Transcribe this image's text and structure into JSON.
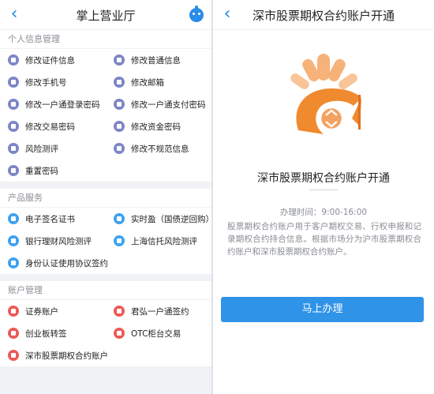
{
  "left": {
    "title": "掌上营业厅",
    "sections": [
      {
        "title": "个人信息管理",
        "items": [
          {
            "label": "修改证件信息",
            "icon": "id-card-icon",
            "color": "#7d86c6"
          },
          {
            "label": "修改普通信息",
            "icon": "pencil-icon",
            "color": "#7d86c6"
          },
          {
            "label": "修改手机号",
            "icon": "phone-icon",
            "color": "#7d86c6"
          },
          {
            "label": "修改邮箱",
            "icon": "mail-icon",
            "color": "#7d86c6"
          },
          {
            "label": "修改一户通登录密码",
            "icon": "login-key-icon",
            "color": "#7d86c6"
          },
          {
            "label": "修改一户通支付密码",
            "icon": "pay-key-icon",
            "color": "#7d86c6"
          },
          {
            "label": "修改交易密码",
            "icon": "trade-password-icon",
            "color": "#7d86c6"
          },
          {
            "label": "修改资金密码",
            "icon": "fund-password-icon",
            "color": "#7d86c6"
          },
          {
            "label": "风险测评",
            "icon": "shield-icon",
            "color": "#7d86c6"
          },
          {
            "label": "修改不规范信息",
            "icon": "moon-icon",
            "color": "#7d86c6"
          },
          {
            "label": "重置密码",
            "icon": "lock-icon",
            "color": "#7d86c6"
          }
        ]
      },
      {
        "title": "产品服务",
        "items": [
          {
            "label": "电子签名证书",
            "icon": "certificate-icon",
            "color": "#3fa2f0"
          },
          {
            "label": "实时盈（国债逆回购）",
            "icon": "refresh-icon",
            "color": "#3fa2f0"
          },
          {
            "label": "银行理财风险测评",
            "icon": "bank-icon",
            "color": "#3fa2f0"
          },
          {
            "label": "上海信托风险测评",
            "icon": "shield-check-icon",
            "color": "#3fa2f0"
          },
          {
            "label": "身份认证使用协议签约",
            "icon": "id-sign-icon",
            "color": "#3fa2f0"
          }
        ]
      },
      {
        "title": "账户管理",
        "items": [
          {
            "label": "证券账户",
            "icon": "chart-line-icon",
            "color": "#ec5a55"
          },
          {
            "label": "君弘一户通签约",
            "icon": "sign-icon",
            "color": "#ec5a55"
          },
          {
            "label": "创业板转签",
            "icon": "transfer-icon",
            "color": "#ec5a55"
          },
          {
            "label": "OTC柜台交易",
            "icon": "otc-icon",
            "color": "#ec5a55"
          },
          {
            "label": "深市股票期权合约账户",
            "icon": "option-contract-icon",
            "color": "#ec5a55"
          }
        ]
      }
    ]
  },
  "right": {
    "title": "深市股票期权合约账户开通",
    "heading": "深市股票期权合约账户开通",
    "hours": "办理时间：9:00-16:00",
    "description": "股票期权合约账户用于客户期权交易、行权申报和记录期权合约持合信息。根据市场分为沪市股票期权合约账户和深市股票期权合约账户。",
    "button_label": "马上办理"
  }
}
